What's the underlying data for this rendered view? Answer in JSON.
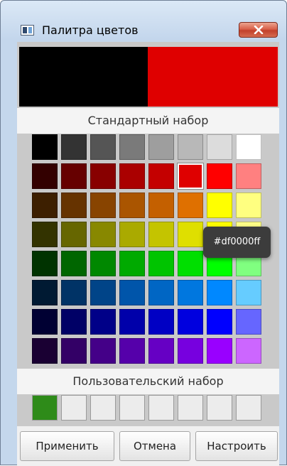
{
  "window": {
    "title": "Палитра цветов",
    "icon": "color-palette-app-icon",
    "close_icon": "close-icon"
  },
  "preview": {
    "old_color": "#000000",
    "new_color": "#df0000"
  },
  "standard": {
    "label": "Стандартный набор",
    "selected_index": 13,
    "colors": [
      "#000000",
      "#333333",
      "#555555",
      "#7a7a7a",
      "#9e9e9e",
      "#b8b8b8",
      "#dcdcdc",
      "#ffffff",
      "#330000",
      "#660000",
      "#880000",
      "#aa0000",
      "#c40000",
      "#df0000",
      "#ff0000",
      "#ff8080",
      "#3d1f00",
      "#663300",
      "#884400",
      "#aa5500",
      "#c46000",
      "#df7000",
      "#ffff00",
      "#ffff80",
      "#333300",
      "#666600",
      "#888800",
      "#aaaa00",
      "#c4c400",
      "#dfdf00",
      "#ffff00",
      "#ffff88",
      "#003300",
      "#006600",
      "#008800",
      "#00aa00",
      "#00c400",
      "#00df00",
      "#00ff00",
      "#80ff80",
      "#001a33",
      "#003366",
      "#004488",
      "#0055aa",
      "#0066c4",
      "#0077df",
      "#0088ff",
      "#66ccff",
      "#000033",
      "#000066",
      "#000088",
      "#0000aa",
      "#0000c4",
      "#0000df",
      "#0000ff",
      "#6666ff",
      "#1a0033",
      "#330066",
      "#440088",
      "#5500aa",
      "#6600c4",
      "#7700df",
      "#9900ff",
      "#cc66ff"
    ]
  },
  "custom": {
    "label": "Пользовательский набор",
    "colors": [
      "#2e8b19",
      "#ececec",
      "#ececec",
      "#ececec",
      "#ececec",
      "#ececec",
      "#ececec",
      "#ececec"
    ]
  },
  "tooltip": {
    "text": "#df0000ff"
  },
  "buttons": {
    "apply": "Применить",
    "cancel": "Отмена",
    "customize": "Настроить"
  }
}
